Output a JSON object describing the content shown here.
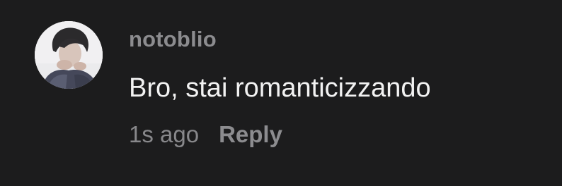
{
  "comment": {
    "username": "notoblio",
    "text": "Bro, stai romanticizzando",
    "timestamp": "1s ago",
    "reply_label": "Reply",
    "avatar_icon": "user-avatar-photo"
  },
  "colors": {
    "background": "#1c1c1d",
    "username": "#8c8c8f",
    "text": "#f2f2f2",
    "meta": "#88888b"
  }
}
